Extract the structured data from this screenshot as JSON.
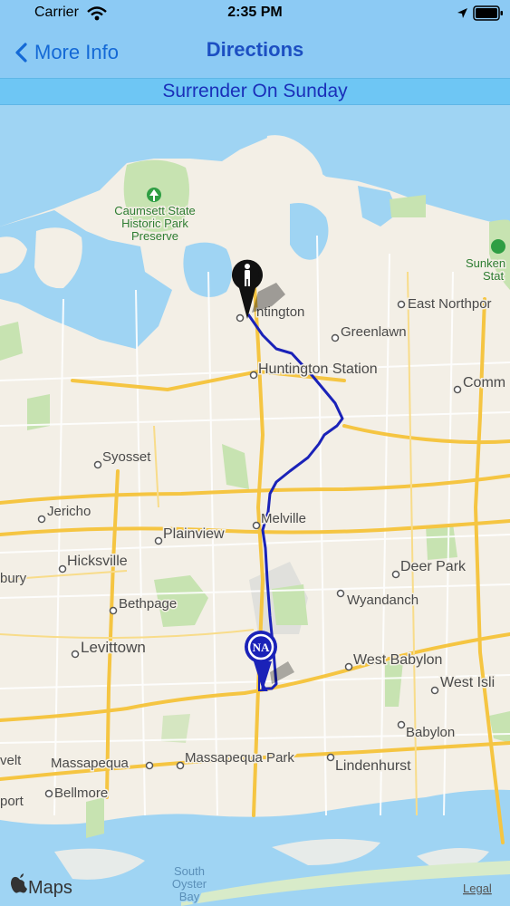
{
  "status_bar": {
    "carrier": "Carrier",
    "time": "2:35 PM"
  },
  "nav": {
    "back_label": "More Info",
    "title": "Directions"
  },
  "banner": {
    "text": "Surrender On Sunday"
  },
  "map": {
    "places": [
      "Caumsett State",
      "Historic Park",
      "Preserve",
      "ntington",
      "East Northpor",
      "Greenlawn",
      "Huntington Station",
      "Comm",
      "Syosset",
      "Jericho",
      "Melville",
      "Plainview",
      "Hicksville",
      "Deer Park",
      "Wyandanch",
      "Bethpage",
      "Levittown",
      "West Babylon",
      "West Isli",
      "Babylon",
      "Massapequa",
      "Massapequa Park",
      "Lindenhurst",
      "Bellmore",
      "Sunken",
      "Stat",
      "bury",
      "velt",
      "port",
      "South",
      "Oyster",
      "Bay"
    ],
    "logo_text": "Maps",
    "legal": "Legal"
  },
  "colors": {
    "route": "#1a22b8",
    "nav_bg": "#8ccaf4",
    "banner_bg": "#6ec6f4",
    "water": "#9fd4f3",
    "land": "#f3efe6",
    "park": "#c7e3b1",
    "road": "#f5c542"
  }
}
